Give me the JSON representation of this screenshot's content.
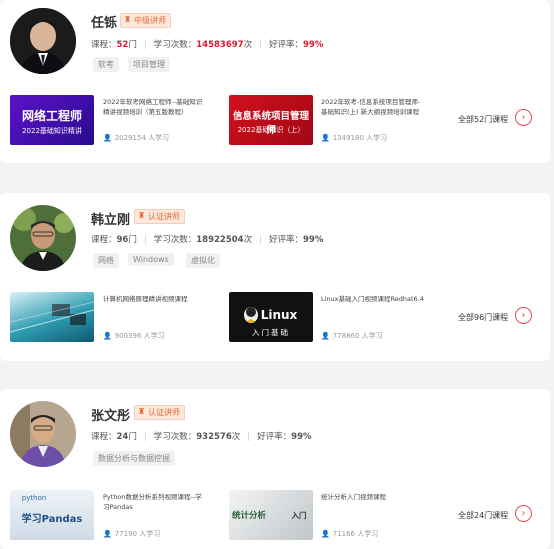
{
  "teachers": [
    {
      "name": "任铄",
      "badge": "中级讲师",
      "stats": {
        "course_label": "课程：",
        "course_count": "52",
        "course_unit": "门",
        "study_label": "学习次数：",
        "study_count": "14583697",
        "study_unit": "次",
        "rating_label": "好评率：",
        "rating": "99%"
      },
      "tags": [
        "软考",
        "项目管理"
      ],
      "courses": [
        {
          "thumb_main": "网络工程师",
          "thumb_sub": "2022基础知识精讲",
          "title": "2022年软考网络工程师--基础知识精讲视频培训（第五版教程）",
          "learners": "2029154 人学习"
        },
        {
          "thumb_main": "信息系统项目管理师",
          "thumb_sub": "2022基础知识（上）",
          "title": "2022年软考-信息系统项目管理师-基础知识(上) 新大纲视频培训课程",
          "learners": "1349180 人学习"
        }
      ],
      "all_link": "全部52门课程"
    },
    {
      "name": "韩立刚",
      "badge": "认证讲师",
      "stats": {
        "course_label": "课程：",
        "course_count": "96",
        "course_unit": "门",
        "study_label": "学习次数：",
        "study_count": "18922504",
        "study_unit": "次",
        "rating_label": "好评率：",
        "rating": "99%"
      },
      "tags": [
        "网络",
        "Windows",
        "虚拟化"
      ],
      "courses": [
        {
          "thumb_main": "",
          "thumb_sub": "",
          "title": "计算机网络原理精讲视频课程",
          "learners": "900396 人学习"
        },
        {
          "thumb_main": "Linux",
          "thumb_sub": "入门基础",
          "title": "Linux基础入门视频课程Redhat6.4",
          "learners": "778860 人学习"
        }
      ],
      "all_link": "全部96门课程"
    },
    {
      "name": "张文彤",
      "badge": "认证讲师",
      "stats": {
        "course_label": "课程：",
        "course_count": "24",
        "course_unit": "门",
        "study_label": "学习次数：",
        "study_count": "932576",
        "study_unit": "次",
        "rating_label": "好评率：",
        "rating": "99%"
      },
      "tags": [
        "数据分析与数据挖掘"
      ],
      "courses": [
        {
          "thumb_main": "学习Pandas",
          "thumb_sub": "python",
          "title": "Python数据分析系列视频课程--学习Pandas",
          "learners": "77190 人学习"
        },
        {
          "thumb_main": "统计分析",
          "thumb_sub": "入门",
          "title": "统计分析入门视频课程",
          "learners": "71166 人学习"
        }
      ],
      "all_link": "全部24门课程"
    }
  ],
  "colors": {
    "accent": "#d8192e",
    "arrow": "#e54a58",
    "badge_bg": "#fde8dd",
    "badge_text": "#e06a33"
  },
  "icons": {
    "user": "user-icon",
    "arrow": "arrow-right-icon",
    "badge": "teacher-badge-icon"
  }
}
